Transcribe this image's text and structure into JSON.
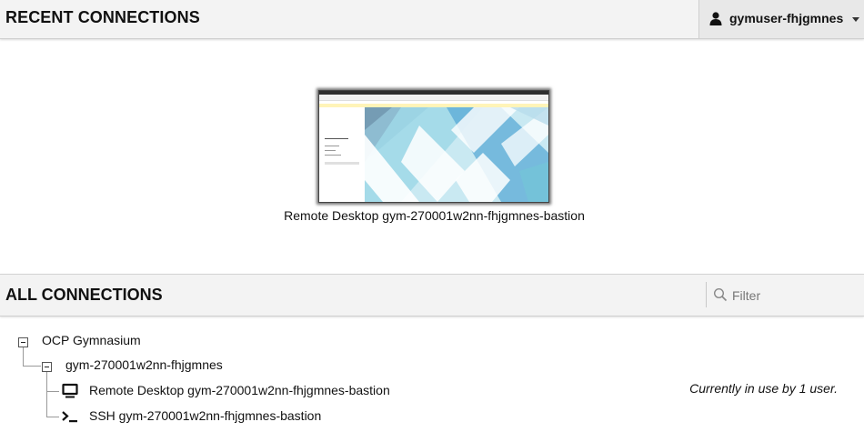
{
  "header": {
    "title": "RECENT CONNECTIONS",
    "username": "gymuser-fhjgmnes"
  },
  "recent": {
    "items": [
      {
        "label": "Remote Desktop gym-270001w2nn-fhjgmnes-bastion"
      }
    ]
  },
  "all_connections": {
    "title": "ALL CONNECTIONS",
    "filter_placeholder": "Filter",
    "tree": {
      "group": "OCP Gymnasium",
      "subgroup": "gym-270001w2nn-fhjgmnes",
      "connections": [
        {
          "label": "Remote Desktop gym-270001w2nn-fhjgmnes-bastion",
          "icon": "monitor-icon",
          "usage": "Currently in use by 1 user."
        },
        {
          "label": "SSH gym-270001w2nn-fhjgmnes-bastion",
          "icon": "terminal-icon",
          "usage": ""
        }
      ]
    }
  },
  "colors": {
    "header_bg": "#f3f3f3",
    "user_menu_bg": "#e8e8e8",
    "pattern_light": "#9fd8e8",
    "pattern_mid": "#5aa9d6",
    "pattern_dark": "#6b8fa8"
  }
}
